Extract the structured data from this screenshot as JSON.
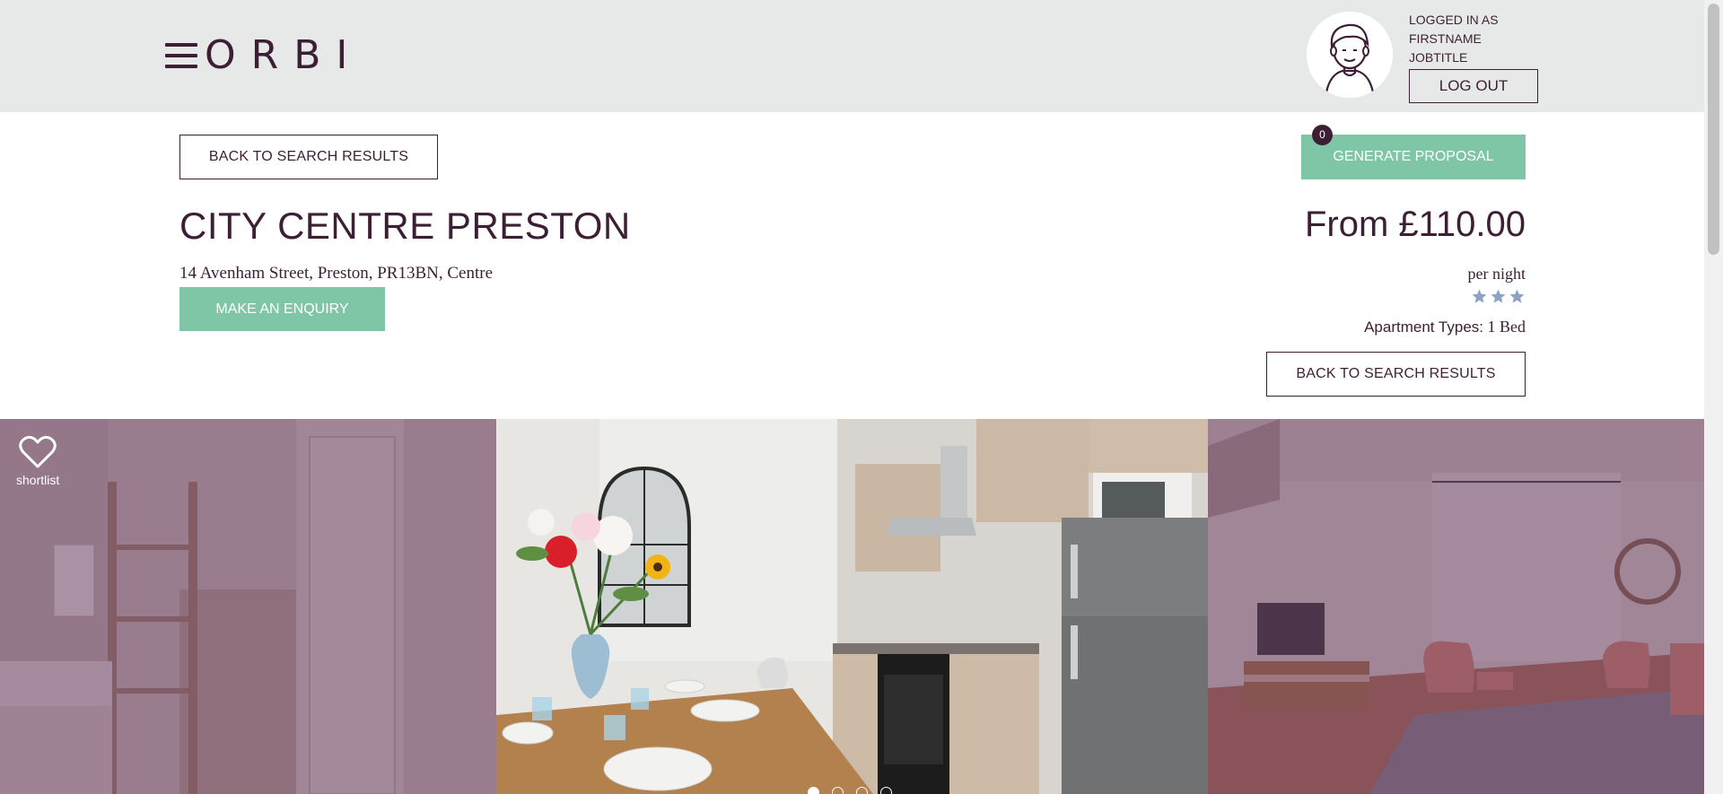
{
  "header": {
    "logo_text": "ORBI",
    "user_lines": [
      "LOGGED IN AS",
      "FIRSTNAME",
      "JOBTITLE"
    ],
    "logout_label": "LOG OUT"
  },
  "property": {
    "back_label_top": "BACK TO SEARCH RESULTS",
    "back_label_bottom": "BACK TO SEARCH RESULTS",
    "proposal_label": "GENERATE PROPOSAL",
    "proposal_count": "0",
    "title": "CITY CENTRE PRESTON",
    "address": "14 Avenham Street, Preston, PR13BN, Centre",
    "enquiry_label": "MAKE AN ENQUIRY",
    "price": "From £110.00",
    "price_unit": "per night",
    "star_rating": 3,
    "apartment_types_label": "Apartment Types:",
    "apartment_types_value": "1 Bed"
  },
  "gallery": {
    "shortlist_label": "shortlist",
    "slide_count": 4,
    "active_slide": 1
  },
  "colors": {
    "brand": "#3d1f35",
    "accent_green": "#7ec6a5",
    "header_bg": "#e6e9e8",
    "star": "#8ea2c4"
  }
}
